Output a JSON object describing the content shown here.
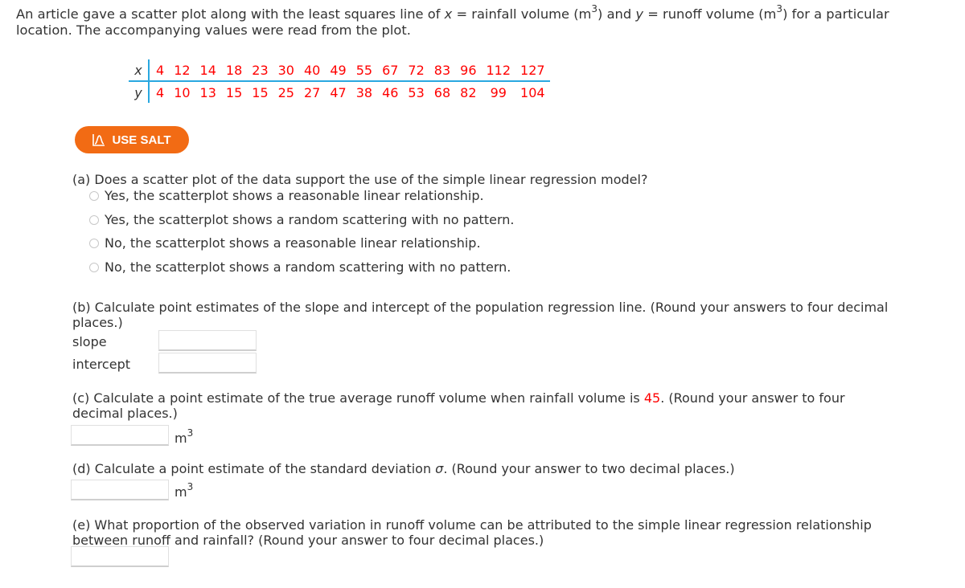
{
  "intro": {
    "part1": "An article gave a scatter plot along with the least squares line of ",
    "x_var": "x",
    "part2": " = rainfall volume (m",
    "sup1": "3",
    "part3": ") and ",
    "y_var": "y",
    "part4": " = runoff volume (m",
    "sup2": "3",
    "part5": ") for a particular",
    "line2": "location. The accompanying values were read from the plot."
  },
  "table": {
    "x_label": "x",
    "y_label": "y",
    "x_values": [
      "4",
      "12",
      "14",
      "18",
      "23",
      "30",
      "40",
      "49",
      "55",
      "67",
      "72",
      "83",
      "96",
      "112",
      "127"
    ],
    "y_values": [
      "4",
      "10",
      "13",
      "15",
      "15",
      "25",
      "27",
      "47",
      "38",
      "46",
      "53",
      "68",
      "82",
      "99",
      "104"
    ]
  },
  "salt_button": {
    "label": "USE SALT",
    "icon": "salt-chart-icon"
  },
  "part_a": {
    "question": "(a) Does a scatter plot of the data support the use of the simple linear regression model?",
    "options": [
      "Yes, the scatterplot shows a reasonable linear relationship.",
      "Yes, the scatterplot shows a random scattering with no pattern.",
      "No, the scatterplot shows a reasonable linear relationship.",
      "No, the scatterplot shows a random scattering with no pattern."
    ]
  },
  "part_b": {
    "line1": "(b) Calculate point estimates of the slope and intercept of the population regression line. (Round your answers to four decimal",
    "line2": "places.)",
    "slope_label": "slope",
    "intercept_label": "intercept",
    "slope_value": "",
    "intercept_value": ""
  },
  "part_c": {
    "line1a": "(c) Calculate a point estimate of the true average runoff volume when rainfall volume is ",
    "highlight": "45",
    "line1b": ". (Round your answer to four",
    "line2": "decimal places.)",
    "value": "",
    "unit": "m",
    "unit_sup": "3"
  },
  "part_d": {
    "line1a": "(d) Calculate a point estimate of the standard deviation ",
    "sigma": "σ",
    "line1b": ". (Round your answer to two decimal places.)",
    "value": "",
    "unit": "m",
    "unit_sup": "3"
  },
  "part_e": {
    "line1": "(e) What proportion of the observed variation in runoff volume can be attributed to the simple linear regression relationship",
    "line2": "between runoff and rainfall? (Round your answer to four decimal places.)",
    "value": ""
  }
}
